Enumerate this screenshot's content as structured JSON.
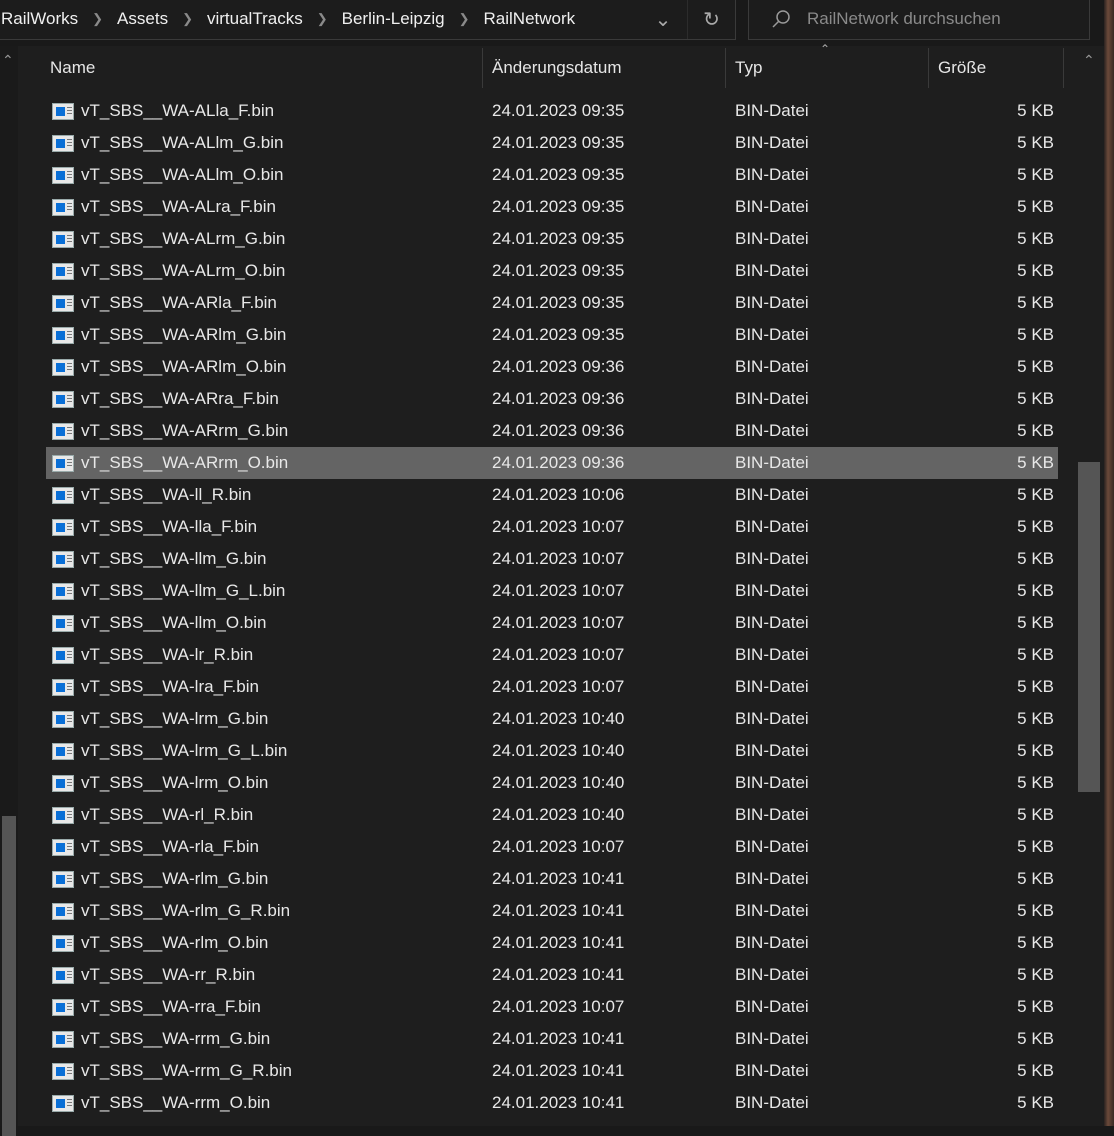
{
  "breadcrumb": [
    "RailWorks",
    "Assets",
    "virtualTracks",
    "Berlin-Leipzig",
    "RailNetwork"
  ],
  "search": {
    "placeholder": "RailNetwork durchsuchen"
  },
  "columns": {
    "name": "Name",
    "date": "Änderungsdatum",
    "type": "Typ",
    "size": "Größe"
  },
  "selected_index": 11,
  "files": [
    {
      "name": "vT_SBS__WA-ALla_F.bin",
      "date": "24.01.2023 09:35",
      "type": "BIN-Datei",
      "size": "5 KB"
    },
    {
      "name": "vT_SBS__WA-ALlm_G.bin",
      "date": "24.01.2023 09:35",
      "type": "BIN-Datei",
      "size": "5 KB"
    },
    {
      "name": "vT_SBS__WA-ALlm_O.bin",
      "date": "24.01.2023 09:35",
      "type": "BIN-Datei",
      "size": "5 KB"
    },
    {
      "name": "vT_SBS__WA-ALra_F.bin",
      "date": "24.01.2023 09:35",
      "type": "BIN-Datei",
      "size": "5 KB"
    },
    {
      "name": "vT_SBS__WA-ALrm_G.bin",
      "date": "24.01.2023 09:35",
      "type": "BIN-Datei",
      "size": "5 KB"
    },
    {
      "name": "vT_SBS__WA-ALrm_O.bin",
      "date": "24.01.2023 09:35",
      "type": "BIN-Datei",
      "size": "5 KB"
    },
    {
      "name": "vT_SBS__WA-ARla_F.bin",
      "date": "24.01.2023 09:35",
      "type": "BIN-Datei",
      "size": "5 KB"
    },
    {
      "name": "vT_SBS__WA-ARlm_G.bin",
      "date": "24.01.2023 09:35",
      "type": "BIN-Datei",
      "size": "5 KB"
    },
    {
      "name": "vT_SBS__WA-ARlm_O.bin",
      "date": "24.01.2023 09:36",
      "type": "BIN-Datei",
      "size": "5 KB"
    },
    {
      "name": "vT_SBS__WA-ARra_F.bin",
      "date": "24.01.2023 09:36",
      "type": "BIN-Datei",
      "size": "5 KB"
    },
    {
      "name": "vT_SBS__WA-ARrm_G.bin",
      "date": "24.01.2023 09:36",
      "type": "BIN-Datei",
      "size": "5 KB"
    },
    {
      "name": "vT_SBS__WA-ARrm_O.bin",
      "date": "24.01.2023 09:36",
      "type": "BIN-Datei",
      "size": "5 KB"
    },
    {
      "name": "vT_SBS__WA-ll_R.bin",
      "date": "24.01.2023 10:06",
      "type": "BIN-Datei",
      "size": "5 KB"
    },
    {
      "name": "vT_SBS__WA-lla_F.bin",
      "date": "24.01.2023 10:07",
      "type": "BIN-Datei",
      "size": "5 KB"
    },
    {
      "name": "vT_SBS__WA-llm_G.bin",
      "date": "24.01.2023 10:07",
      "type": "BIN-Datei",
      "size": "5 KB"
    },
    {
      "name": "vT_SBS__WA-llm_G_L.bin",
      "date": "24.01.2023 10:07",
      "type": "BIN-Datei",
      "size": "5 KB"
    },
    {
      "name": "vT_SBS__WA-llm_O.bin",
      "date": "24.01.2023 10:07",
      "type": "BIN-Datei",
      "size": "5 KB"
    },
    {
      "name": "vT_SBS__WA-lr_R.bin",
      "date": "24.01.2023 10:07",
      "type": "BIN-Datei",
      "size": "5 KB"
    },
    {
      "name": "vT_SBS__WA-lra_F.bin",
      "date": "24.01.2023 10:07",
      "type": "BIN-Datei",
      "size": "5 KB"
    },
    {
      "name": "vT_SBS__WA-lrm_G.bin",
      "date": "24.01.2023 10:40",
      "type": "BIN-Datei",
      "size": "5 KB"
    },
    {
      "name": "vT_SBS__WA-lrm_G_L.bin",
      "date": "24.01.2023 10:40",
      "type": "BIN-Datei",
      "size": "5 KB"
    },
    {
      "name": "vT_SBS__WA-lrm_O.bin",
      "date": "24.01.2023 10:40",
      "type": "BIN-Datei",
      "size": "5 KB"
    },
    {
      "name": "vT_SBS__WA-rl_R.bin",
      "date": "24.01.2023 10:40",
      "type": "BIN-Datei",
      "size": "5 KB"
    },
    {
      "name": "vT_SBS__WA-rla_F.bin",
      "date": "24.01.2023 10:07",
      "type": "BIN-Datei",
      "size": "5 KB"
    },
    {
      "name": "vT_SBS__WA-rlm_G.bin",
      "date": "24.01.2023 10:41",
      "type": "BIN-Datei",
      "size": "5 KB"
    },
    {
      "name": "vT_SBS__WA-rlm_G_R.bin",
      "date": "24.01.2023 10:41",
      "type": "BIN-Datei",
      "size": "5 KB"
    },
    {
      "name": "vT_SBS__WA-rlm_O.bin",
      "date": "24.01.2023 10:41",
      "type": "BIN-Datei",
      "size": "5 KB"
    },
    {
      "name": "vT_SBS__WA-rr_R.bin",
      "date": "24.01.2023 10:41",
      "type": "BIN-Datei",
      "size": "5 KB"
    },
    {
      "name": "vT_SBS__WA-rra_F.bin",
      "date": "24.01.2023 10:07",
      "type": "BIN-Datei",
      "size": "5 KB"
    },
    {
      "name": "vT_SBS__WA-rrm_G.bin",
      "date": "24.01.2023 10:41",
      "type": "BIN-Datei",
      "size": "5 KB"
    },
    {
      "name": "vT_SBS__WA-rrm_G_R.bin",
      "date": "24.01.2023 10:41",
      "type": "BIN-Datei",
      "size": "5 KB"
    },
    {
      "name": "vT_SBS__WA-rrm_O.bin",
      "date": "24.01.2023 10:41",
      "type": "BIN-Datei",
      "size": "5 KB"
    }
  ]
}
